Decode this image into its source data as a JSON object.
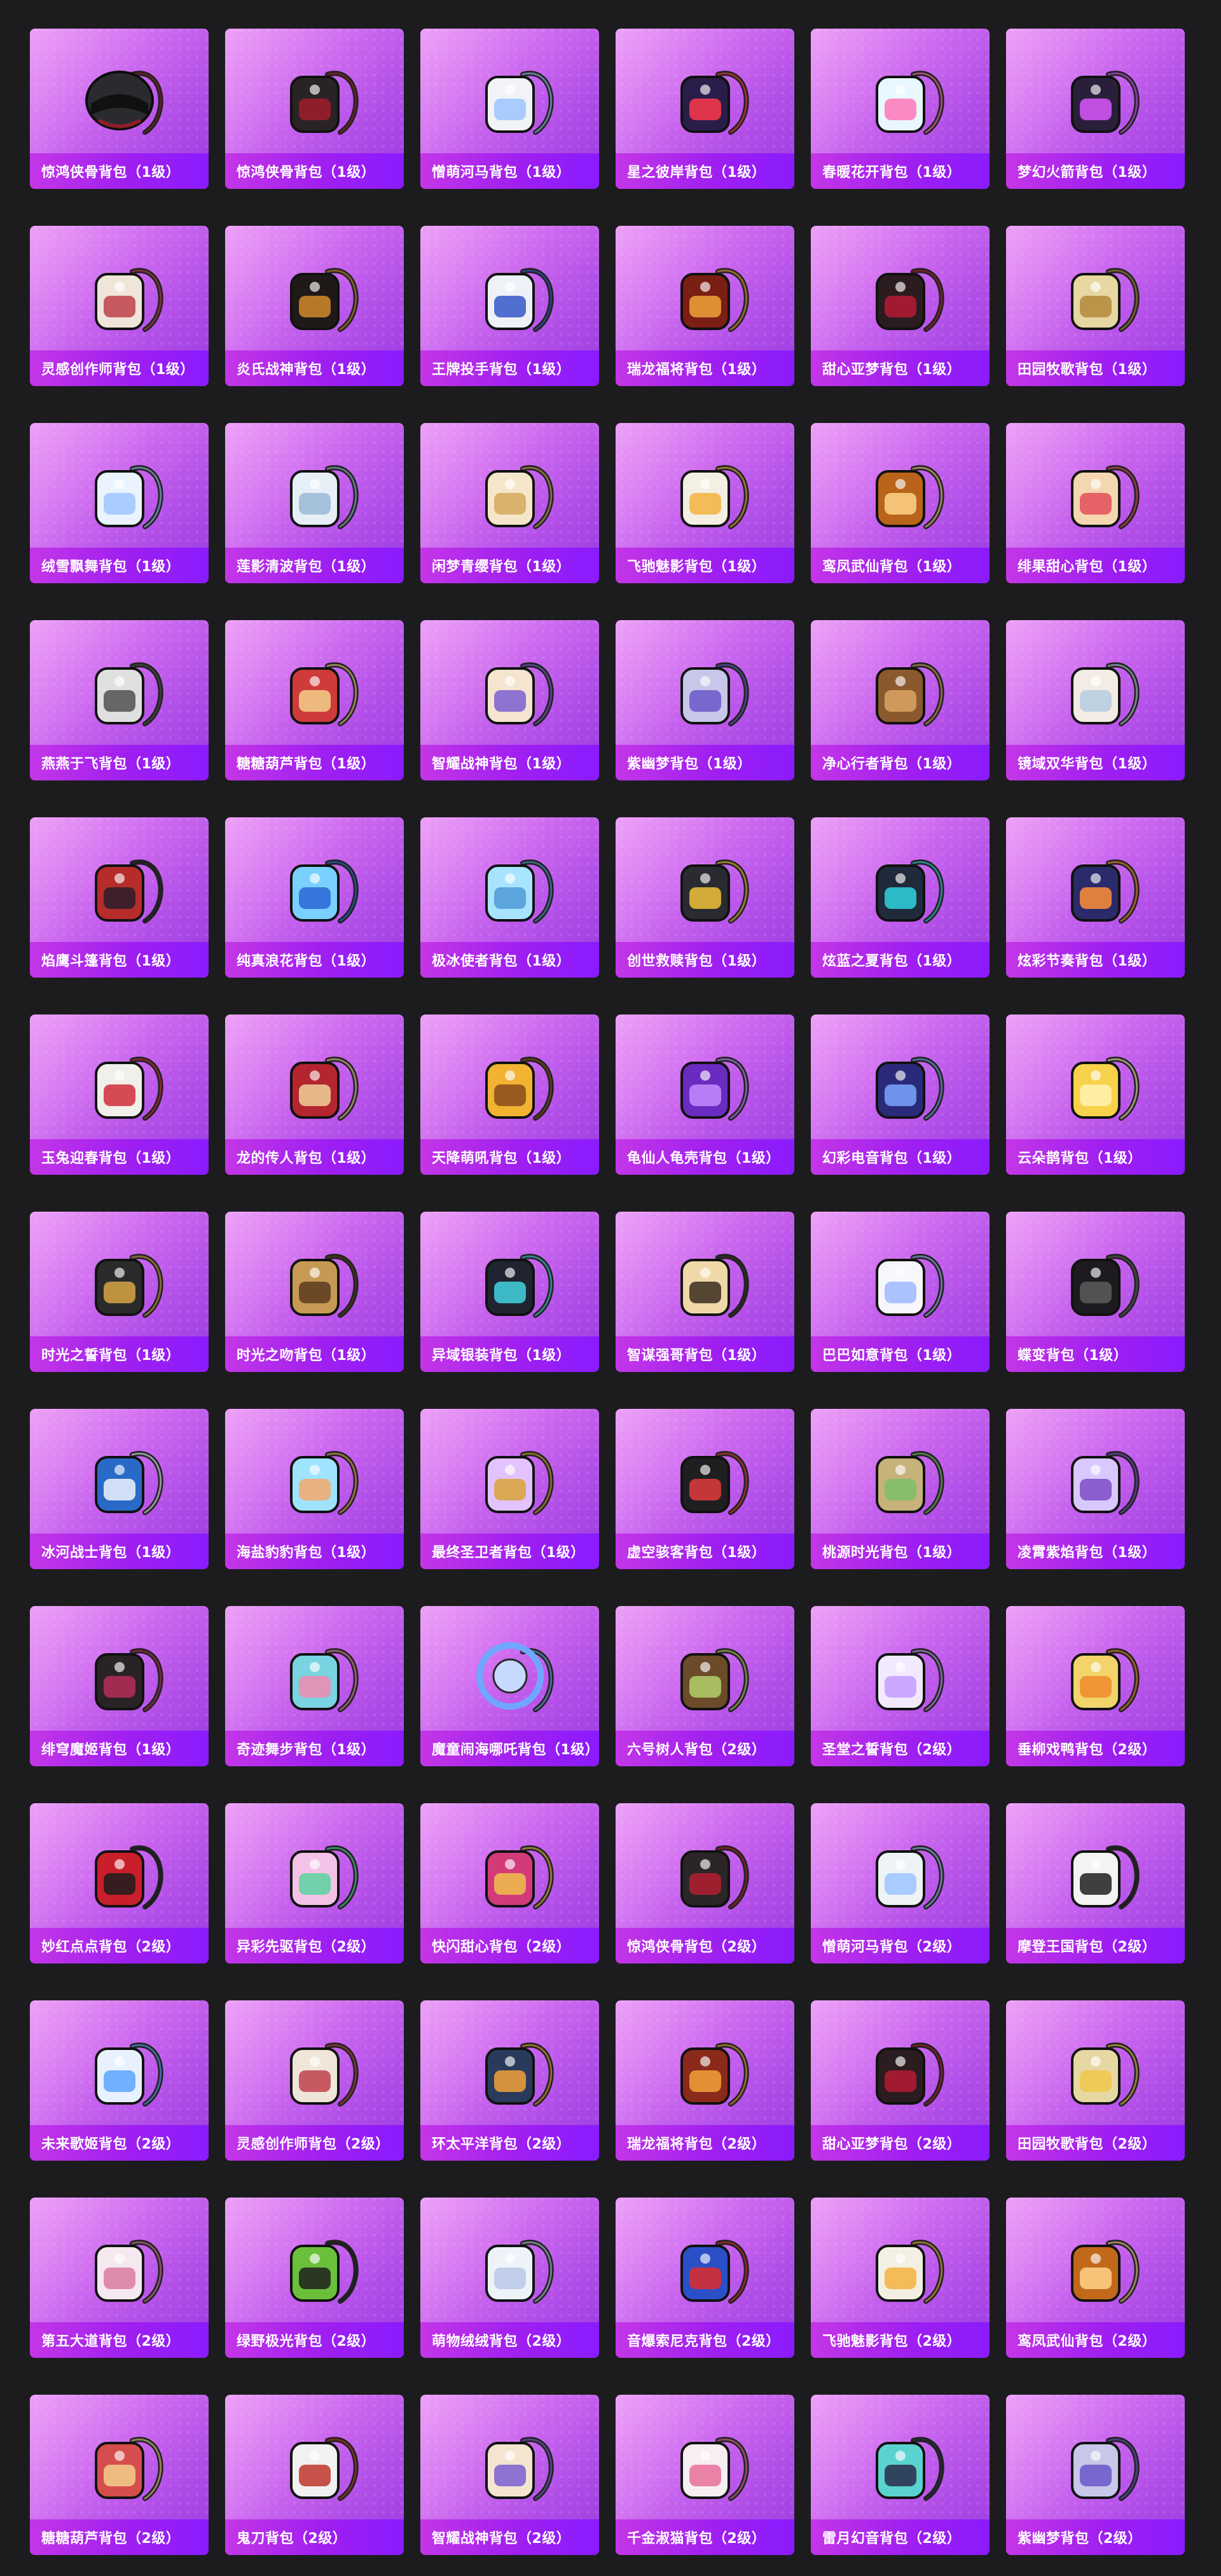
{
  "items": [
    {
      "label": "惊鸿侠骨背包（1级）",
      "icon": "helmet-icon",
      "color": "#2b2b2f",
      "accent": "#8a1f2a"
    },
    {
      "label": "惊鸿侠骨背包（1级）",
      "icon": "backpack-icon",
      "color": "#2a2326",
      "accent": "#a21c2b"
    },
    {
      "label": "憎萌河马背包（1级）",
      "icon": "hippo-backpack-icon",
      "color": "#f1f3f6",
      "accent": "#9ec3ff"
    },
    {
      "label": "星之彼岸背包（1级）",
      "icon": "astronaut-backpack-icon",
      "color": "#2b1d4a",
      "accent": "#ff3a4a"
    },
    {
      "label": "春暖花开背包（1级）",
      "icon": "flower-backpack-icon",
      "color": "#e9f7ff",
      "accent": "#ff77b7"
    },
    {
      "label": "梦幻火箭背包（1级）",
      "icon": "rocket-backpack-icon",
      "color": "#2a1f3a",
      "accent": "#d957ff"
    },
    {
      "label": "灵感创作师背包（1级）",
      "icon": "sack-backpack-icon",
      "color": "#efe6d9",
      "accent": "#c0414a"
    },
    {
      "label": "炎氏战神背包（1级）",
      "icon": "warrior-backpack-icon",
      "color": "#1f1a18",
      "accent": "#d28b2b"
    },
    {
      "label": "王牌投手背包（1级）",
      "icon": "baseball-backpack-icon",
      "color": "#eef2f8",
      "accent": "#3558c7"
    },
    {
      "label": "瑞龙福将背包（1级）",
      "icon": "dragon-backpack-icon",
      "color": "#7b1e14",
      "accent": "#f0a33a"
    },
    {
      "label": "甜心亚梦背包（1级）",
      "icon": "chest-backpack-icon",
      "color": "#2b1c1f",
      "accent": "#b51b35"
    },
    {
      "label": "田园牧歌背包（1级）",
      "icon": "basket-backpack-icon",
      "color": "#e7d7a2",
      "accent": "#b28a3a"
    },
    {
      "label": "绒雪飘舞背包（1级）",
      "icon": "bunny-backpack-icon",
      "color": "#e9f4ff",
      "accent": "#9fc6ff"
    },
    {
      "label": "莲影清波背包（1级）",
      "icon": "dress-backpack-icon",
      "color": "#e6eff5",
      "accent": "#9ab8d6"
    },
    {
      "label": "闲梦青缨背包（1级）",
      "icon": "gourd-backpack-icon",
      "color": "#f5e6c9",
      "accent": "#d3a85b"
    },
    {
      "label": "飞驰魅影背包（1级）",
      "icon": "rabbit-backpack-icon",
      "color": "#f3f0e3",
      "accent": "#f4b23e"
    },
    {
      "label": "鸾凤武仙背包（1级）",
      "icon": "shield-backpack-icon",
      "color": "#b9641a",
      "accent": "#ffd48a"
    },
    {
      "label": "绯果甜心背包（1级）",
      "icon": "fox-backpack-icon",
      "color": "#f4d6b0",
      "accent": "#e24f5b"
    },
    {
      "label": "燕燕于飞背包（1级）",
      "icon": "swallow-backpack-icon",
      "color": "#e0e0e0",
      "accent": "#505050"
    },
    {
      "label": "糖糖葫芦背包（1级）",
      "icon": "gourd-backpack-icon",
      "color": "#cf3a3a",
      "accent": "#f2d08a"
    },
    {
      "label": "智耀战神背包（1级）",
      "icon": "owl-backpack-icon",
      "color": "#f5e4d0",
      "accent": "#7b5fd1"
    },
    {
      "label": "紫幽梦背包（1级）",
      "icon": "orb-backpack-icon",
      "color": "#c7c7ea",
      "accent": "#6a56c7"
    },
    {
      "label": "净心行者背包（1级）",
      "icon": "gourd-backpack-icon",
      "color": "#8a5a2e",
      "accent": "#d9a461"
    },
    {
      "label": "镜域双华背包（1级）",
      "icon": "heart-backpack-icon",
      "color": "#f2ece4",
      "accent": "#b6cde0"
    },
    {
      "label": "焰鹰斗篷背包（1级）",
      "icon": "eagle-backpack-icon",
      "color": "#b52c2a",
      "accent": "#2a1f2a"
    },
    {
      "label": "纯真浪花背包（1级）",
      "icon": "drink-backpack-icon",
      "color": "#7ad0ff",
      "accent": "#2a67d6"
    },
    {
      "label": "极冰使者背包（1级）",
      "icon": "ice-backpack-icon",
      "color": "#a8e3ff",
      "accent": "#4f9ad8"
    },
    {
      "label": "创世救赎背包（1级）",
      "icon": "mech-backpack-icon",
      "color": "#2a2b30",
      "accent": "#f0c23a"
    },
    {
      "label": "炫蓝之夏背包（1级）",
      "icon": "tech-backpack-icon",
      "color": "#1f2a3a",
      "accent": "#2fd3e0"
    },
    {
      "label": "炫彩节奏背包（1级）",
      "icon": "galaxy-backpack-icon",
      "color": "#2b2a6a",
      "accent": "#ff8f3a"
    },
    {
      "label": "玉兔迎春背包（1级）",
      "icon": "school-backpack-icon",
      "color": "#f0efe9",
      "accent": "#d12d3a"
    },
    {
      "label": "龙的传人背包（1级）",
      "icon": "school-backpack-icon",
      "color": "#b4252f",
      "accent": "#f0d19a"
    },
    {
      "label": "天降萌吼背包（1级）",
      "icon": "tiger-backpack-icon",
      "color": "#f2b232",
      "accent": "#8a4b1a"
    },
    {
      "label": "龟仙人龟壳背包（1级）",
      "icon": "shell-backpack-icon",
      "color": "#6a2bc0",
      "accent": "#c48cff"
    },
    {
      "label": "幻彩电音背包（1级）",
      "icon": "speaker-backpack-icon",
      "color": "#2b2a7a",
      "accent": "#7aa6ff"
    },
    {
      "label": "云朵鹊背包（1级）",
      "icon": "cloud-flower-backpack-icon",
      "color": "#f7d24a",
      "accent": "#fff3b0"
    },
    {
      "label": "时光之誓背包（1级）",
      "icon": "compass-backpack-icon",
      "color": "#2a2a2a",
      "accent": "#d7a445"
    },
    {
      "label": "时光之吻背包（1级）",
      "icon": "pocketwatch-backpack-icon",
      "color": "#c69a54",
      "accent": "#5b3b1f"
    },
    {
      "label": "异域银装背包（1级）",
      "icon": "pouch-backpack-icon",
      "color": "#1f2430",
      "accent": "#43d3e0"
    },
    {
      "label": "智谋强哥背包（1级）",
      "icon": "face-backpack-icon",
      "color": "#f0d8a8",
      "accent": "#3a2b1f"
    },
    {
      "label": "巴巴如意背包（1级）",
      "icon": "ghost-backpack-icon",
      "color": "#f7f7fb",
      "accent": "#9fb8ff"
    },
    {
      "label": "蝶变背包（1级）",
      "icon": "leather-backpack-icon",
      "color": "#1d1b1f",
      "accent": "#5c5c5c"
    },
    {
      "label": "冰河战士背包（1级）",
      "icon": "gear-backpack-icon",
      "color": "#2a6ac7",
      "accent": "#f0f4ff"
    },
    {
      "label": "海盐豹豹背包（1级）",
      "icon": "seal-backpack-icon",
      "color": "#9fe3ff",
      "accent": "#f3a86b"
    },
    {
      "label": "最终圣卫者背包（1级）",
      "icon": "wing-backpack-icon",
      "color": "#e3c3ff",
      "accent": "#d9a437"
    },
    {
      "label": "虚空骇客背包（1级）",
      "icon": "dark-mech-backpack-icon",
      "color": "#1f1f22",
      "accent": "#e23b3b"
    },
    {
      "label": "桃源时光背包（1级）",
      "icon": "box-backpack-icon",
      "color": "#c7b27a",
      "accent": "#7ac06a"
    },
    {
      "label": "凌霄紫焰背包（1级）",
      "icon": "bunny-backpack-icon",
      "color": "#d9c7ff",
      "accent": "#7b4cc6"
    },
    {
      "label": "绯穹魔姬背包（1级）",
      "icon": "bunny-backpack-icon",
      "color": "#2a2326",
      "accent": "#b62e58"
    },
    {
      "label": "奇迹舞步背包（1级）",
      "icon": "bear-backpack-icon",
      "color": "#7ad3e0",
      "accent": "#f08ab0"
    },
    {
      "label": "魔童闹海哪吒背包（1级）",
      "icon": "ring-backpack-icon",
      "color": "#c7d9ff",
      "accent": "#6fa7ff"
    },
    {
      "label": "六号树人背包（2级）",
      "icon": "treehouse-backpack-icon",
      "color": "#6b4b2a",
      "accent": "#b3d06a"
    },
    {
      "label": "圣堂之誓背包（2级）",
      "icon": "fairy-backpack-icon",
      "color": "#f3e9ff",
      "accent": "#c39cff"
    },
    {
      "label": "垂柳戏鸭背包（2级）",
      "icon": "duck-backpack-icon",
      "color": "#f2d46a",
      "accent": "#f08a2a"
    },
    {
      "label": "妙红点点背包（2级）",
      "icon": "ladybug-backpack-icon",
      "color": "#c81f2b",
      "accent": "#1d1d1d"
    },
    {
      "label": "异彩先驱背包（2级）",
      "icon": "graffiti-backpack-icon",
      "color": "#f5c2e7",
      "accent": "#5ad3a0"
    },
    {
      "label": "快闪甜心背包（2级）",
      "icon": "jar-backpack-icon",
      "color": "#d23a7a",
      "accent": "#f0c04a"
    },
    {
      "label": "惊鸿侠骨背包（2级）",
      "icon": "backpack-icon",
      "color": "#2b2528",
      "accent": "#b31f2f"
    },
    {
      "label": "憎萌河马背包（2级）",
      "icon": "hippo-backpack-icon",
      "color": "#eef3f5",
      "accent": "#9ec3ff"
    },
    {
      "label": "摩登王国背包（2级）",
      "icon": "rabbit-backpack-icon",
      "color": "#f3f3f3",
      "accent": "#1e1e1e"
    },
    {
      "label": "未来歌姬背包（2级）",
      "icon": "idol-backpack-icon",
      "color": "#e8f2ff",
      "accent": "#5aa6ff"
    },
    {
      "label": "灵感创作师背包（2级）",
      "icon": "sack-backpack-icon",
      "color": "#efe6d9",
      "accent": "#c0414a"
    },
    {
      "label": "环太平洋背包（2级）",
      "icon": "robot-backpack-icon",
      "color": "#2a3a5a",
      "accent": "#f2a23a"
    },
    {
      "label": "瑞龙福将背包（2级）",
      "icon": "dragon-backpack-icon",
      "color": "#8a2a1a",
      "accent": "#f0a33a"
    },
    {
      "label": "甜心亚梦背包（2级）",
      "icon": "chest-backpack-icon",
      "color": "#2b1c1f",
      "accent": "#b51b35"
    },
    {
      "label": "田园牧歌背包（2级）",
      "icon": "basket-backpack-icon",
      "color": "#e7d7a2",
      "accent": "#f0c84a"
    },
    {
      "label": "第五大道背包（2级）",
      "icon": "handbag-backpack-icon",
      "color": "#f5e9ef",
      "accent": "#d97aa0"
    },
    {
      "label": "绿野极光背包（2级）",
      "icon": "arcade-backpack-icon",
      "color": "#6ac03a",
      "accent": "#1f1f1f"
    },
    {
      "label": "萌物绒绒背包（2级）",
      "icon": "plush-backpack-icon",
      "color": "#eef3fa",
      "accent": "#b8c8e6"
    },
    {
      "label": "音爆索尼克背包（2级）",
      "icon": "sonic-backpack-icon",
      "color": "#2a4fc7",
      "accent": "#e02a2a"
    },
    {
      "label": "飞驰魅影背包（2级）",
      "icon": "rabbit-backpack-icon",
      "color": "#f3f0e3",
      "accent": "#f4b23e"
    },
    {
      "label": "鸾凤武仙背包（2级）",
      "icon": "shield-backpack-icon",
      "color": "#c2681a",
      "accent": "#ffd48a"
    },
    {
      "label": "糖糖葫芦背包（2级）",
      "icon": "gourd-backpack-icon",
      "color": "#d64d4d",
      "accent": "#f2d08a"
    },
    {
      "label": "鬼刀背包（2级）",
      "icon": "ghostblade-backpack-icon",
      "color": "#f1f1f1",
      "accent": "#c0362b"
    },
    {
      "label": "智耀战神背包（2级）",
      "icon": "owl-backpack-icon",
      "color": "#f5e4d0",
      "accent": "#7b5fd1"
    },
    {
      "label": "千金淑猫背包（2级）",
      "icon": "cat-backpack-icon",
      "color": "#f7eef2",
      "accent": "#e76f9b"
    },
    {
      "label": "雷月幻音背包（2级）",
      "icon": "headphone-backpack-icon",
      "color": "#5ad3d0",
      "accent": "#2a2a4a"
    },
    {
      "label": "紫幽梦背包（2级）",
      "icon": "orb-backpack-icon",
      "color": "#c7c7ea",
      "accent": "#6a56c7"
    }
  ]
}
